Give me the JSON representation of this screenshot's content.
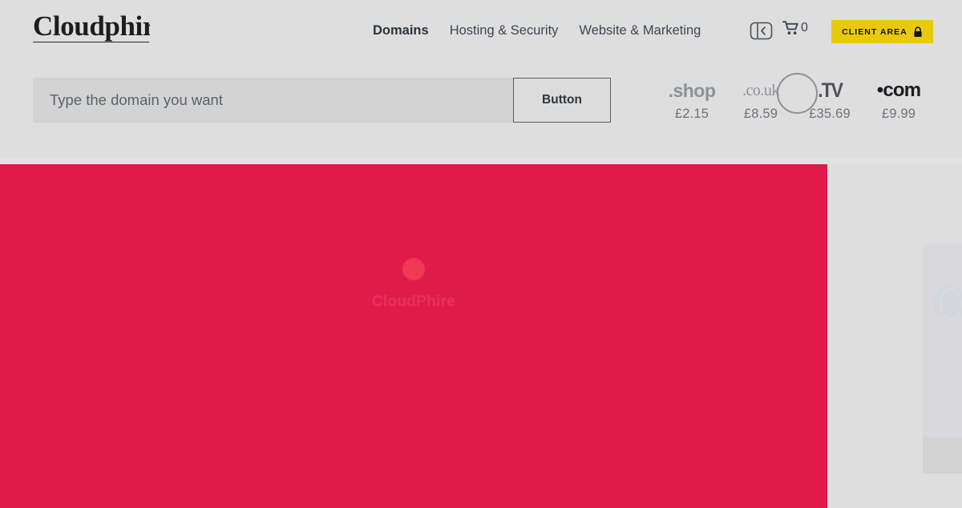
{
  "site": {
    "brand": "Cloudphire"
  },
  "header": {
    "nav": [
      {
        "label": "Domains",
        "active": true
      },
      {
        "label": "Hosting & Security",
        "active": false
      },
      {
        "label": "Website & Marketing",
        "active": false
      }
    ],
    "panel_toggle_icon": "sidebar-collapse-icon",
    "cart": {
      "icon": "shopping-cart-icon",
      "count": "0"
    },
    "client_area": {
      "label": "CLIENT AREA",
      "icon": "lock-icon",
      "background": "#e9c90c",
      "text_color": "#14161a"
    }
  },
  "search": {
    "placeholder": "Type the domain you want",
    "value": "",
    "button_label": "Button"
  },
  "tlds": [
    {
      "name": ".shop",
      "display": ".shop",
      "price": "£2.15",
      "style": "shop"
    },
    {
      "name": ".co.uk",
      "display": ".co.uk",
      "price": "£8.59",
      "style": "couk"
    },
    {
      "name": ".TV",
      "display": ".TV",
      "price": "£35.69",
      "style": "tv"
    },
    {
      "name": ".com",
      "display": "•com",
      "price": "£9.99",
      "style": "com"
    }
  ],
  "hero": {
    "background": "#e01b4c",
    "loader": {
      "icon": "loading-spinner-dot",
      "text": "CloudPhire"
    }
  },
  "colors": {
    "page_background": "#dedede",
    "hero_background": "#e01b4c",
    "accent_yellow": "#e9c90c",
    "text_primary": "#2d333b",
    "text_muted": "#6d7278"
  }
}
